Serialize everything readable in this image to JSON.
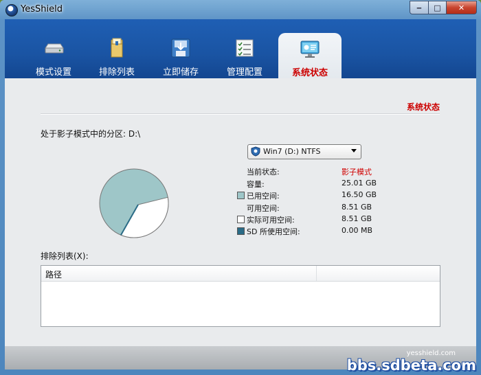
{
  "window": {
    "title": "YesShield",
    "buttons": {
      "minimize": "‒",
      "maximize": "□",
      "close": "✕"
    }
  },
  "tabs": [
    {
      "label": "模式设置",
      "icon": "drive-icon"
    },
    {
      "label": "排除列表",
      "icon": "folder-icon"
    },
    {
      "label": "立即储存",
      "icon": "save-icon"
    },
    {
      "label": "管理配置",
      "icon": "checklist-icon"
    },
    {
      "label": "系统状态",
      "icon": "monitor-icon",
      "active": true
    }
  ],
  "status": {
    "section_title": "系统状态",
    "partition_label": "处于影子模式中的分区:  D:\\",
    "drive_select": "Win7 (D:) NTFS",
    "rows": [
      {
        "label": "当前状态:",
        "value": "影子模式",
        "value_color": "#d00000"
      },
      {
        "label": "容量:",
        "value": "25.01 GB"
      },
      {
        "label": "已用空间:",
        "value": "16.50 GB",
        "swatch": "#9ec6c8"
      },
      {
        "label": "可用空间:",
        "value": "8.51 GB"
      },
      {
        "label": "实际可用空间:",
        "value": "8.51 GB",
        "swatch": "#ffffff"
      },
      {
        "label": "SD 所使用空间:",
        "value": "0.00 MB",
        "swatch": "#2a6b86"
      }
    ],
    "pie": {
      "used_fraction": 0.66,
      "colors": {
        "used": "#9ec6c8",
        "free": "#ffffff",
        "sd": "#2a6b86"
      }
    }
  },
  "exclude": {
    "label": "排除列表(X):",
    "columns": [
      "路径",
      ""
    ]
  },
  "watermark": {
    "main": "bbs.sdbeta.com",
    "small": "yesshield.com"
  }
}
